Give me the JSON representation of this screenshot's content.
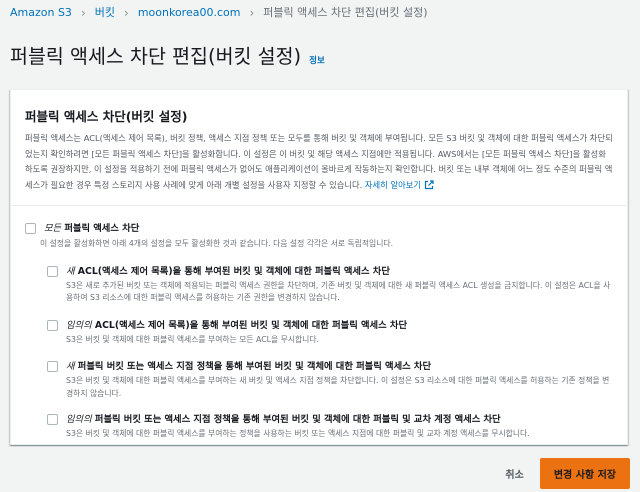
{
  "breadcrumb": {
    "items": [
      "Amazon S3",
      "버킷",
      "moonkorea00.com",
      "퍼블릭 액세스 차단 편집(버킷 설정)"
    ],
    "separator": "›"
  },
  "page": {
    "title": "퍼블릭 액세스 차단 편집(버킷 설정)",
    "info_label": "정보"
  },
  "panel": {
    "title": "퍼블릭 액세스 차단(버킷 설정)",
    "description": "퍼블릭 액세스는 ACL(액세스 제어 목록), 버킷 정책, 액세스 지점 정책 또는 모두를 통해 버킷 및 객체에 부여됩니다. 모든 S3 버킷 및 객체에 대한 퍼블릭 액세스가 차단되었는지 확인하려면 [모든 퍼블릭 액세스 차단]을 활성화합니다. 이 설정은 이 버킷 및 해당 액세스 지점에만 적용됩니다. AWS에서는 [모든 퍼블릭 액세스 차단]을 활성화하도록 권장하지만, 이 설정을 적용하기 전에 퍼블릭 액세스가 없어도 애플리케이션이 올바르게 작동하는지 확인합니다. 버킷 또는 내부 객체에 어느 정도 수준의 퍼블릭 액세스가 필요한 경우 특정 스토리지 사용 사례에 맞게 아래 개별 설정을 사용자 지정할 수 있습니다.",
    "learn_more": "자세히 알아보기"
  },
  "options": {
    "block_all": {
      "label_italic": "모든",
      "label": " 퍼블릭 액세스 차단",
      "desc": "이 설정을 활성화하면 아래 4개의 설정을 모두 활성화한 것과 같습니다. 다음 설정 각각은 서로 독립적입니다.",
      "checked": false
    },
    "new_acl": {
      "label_italic": "새",
      "label": " ACL(액세스 제어 목록)을 통해 부여된 버킷 및 객체에 대한 퍼블릭 액세스 차단",
      "desc": "S3은 새로 추가된 버킷 또는 객체에 적용되는 퍼블릭 액세스 권한을 차단하며, 기존 버킷 및 객체에 대한 새 퍼블릭 액세스 ACL 생성을 금지합니다. 이 설정은 ACL을 사용하여 S3 리소스에 대한 퍼블릭 액세스를 허용하는 기존 권한을 변경하지 않습니다.",
      "checked": false
    },
    "any_acl": {
      "label_italic": "임의의",
      "label": " ACL(액세스 제어 목록)을 통해 부여된 버킷 및 객체에 대한 퍼블릭 액세스 차단",
      "desc": "S3은 버킷 및 객체에 대한 퍼블릭 액세스를 부여하는 모든 ACL을 무시합니다.",
      "checked": false
    },
    "new_policy": {
      "label_italic": "새",
      "label": " 퍼블릭 버킷 또는 액세스 지점 정책을 통해 부여된 버킷 및 객체에 대한 퍼블릭 액세스 차단",
      "desc": "S3은 버킷 및 객체에 대한 퍼블릭 액세스를 부여하는 새 버킷 및 액세스 지점 정책을 차단합니다. 이 설정은 S3 리소스에 대한 퍼블릭 액세스를 허용하는 기존 정책을 변경하지 않습니다.",
      "checked": false
    },
    "any_policy": {
      "label_italic": "임의의",
      "label": " 퍼블릭 버킷 또는 액세스 지점 정책을 통해 부여된 버킷 및 객체에 대한 퍼블릭 및 교차 계정 액세스 차단",
      "desc": "S3은 버킷 및 객체에 대한 퍼블릭 액세스를 부여하는 정책을 사용하는 버킷 또는 액세스 지점에 대한 퍼블릭 및 교차 계정 액세스를 무시합니다.",
      "checked": false
    }
  },
  "footer": {
    "cancel_label": "취소",
    "save_label": "변경 사항 저장"
  },
  "colors": {
    "link": "#0073bb",
    "primary_button": "#ec7211",
    "background": "#f2f3f3"
  }
}
